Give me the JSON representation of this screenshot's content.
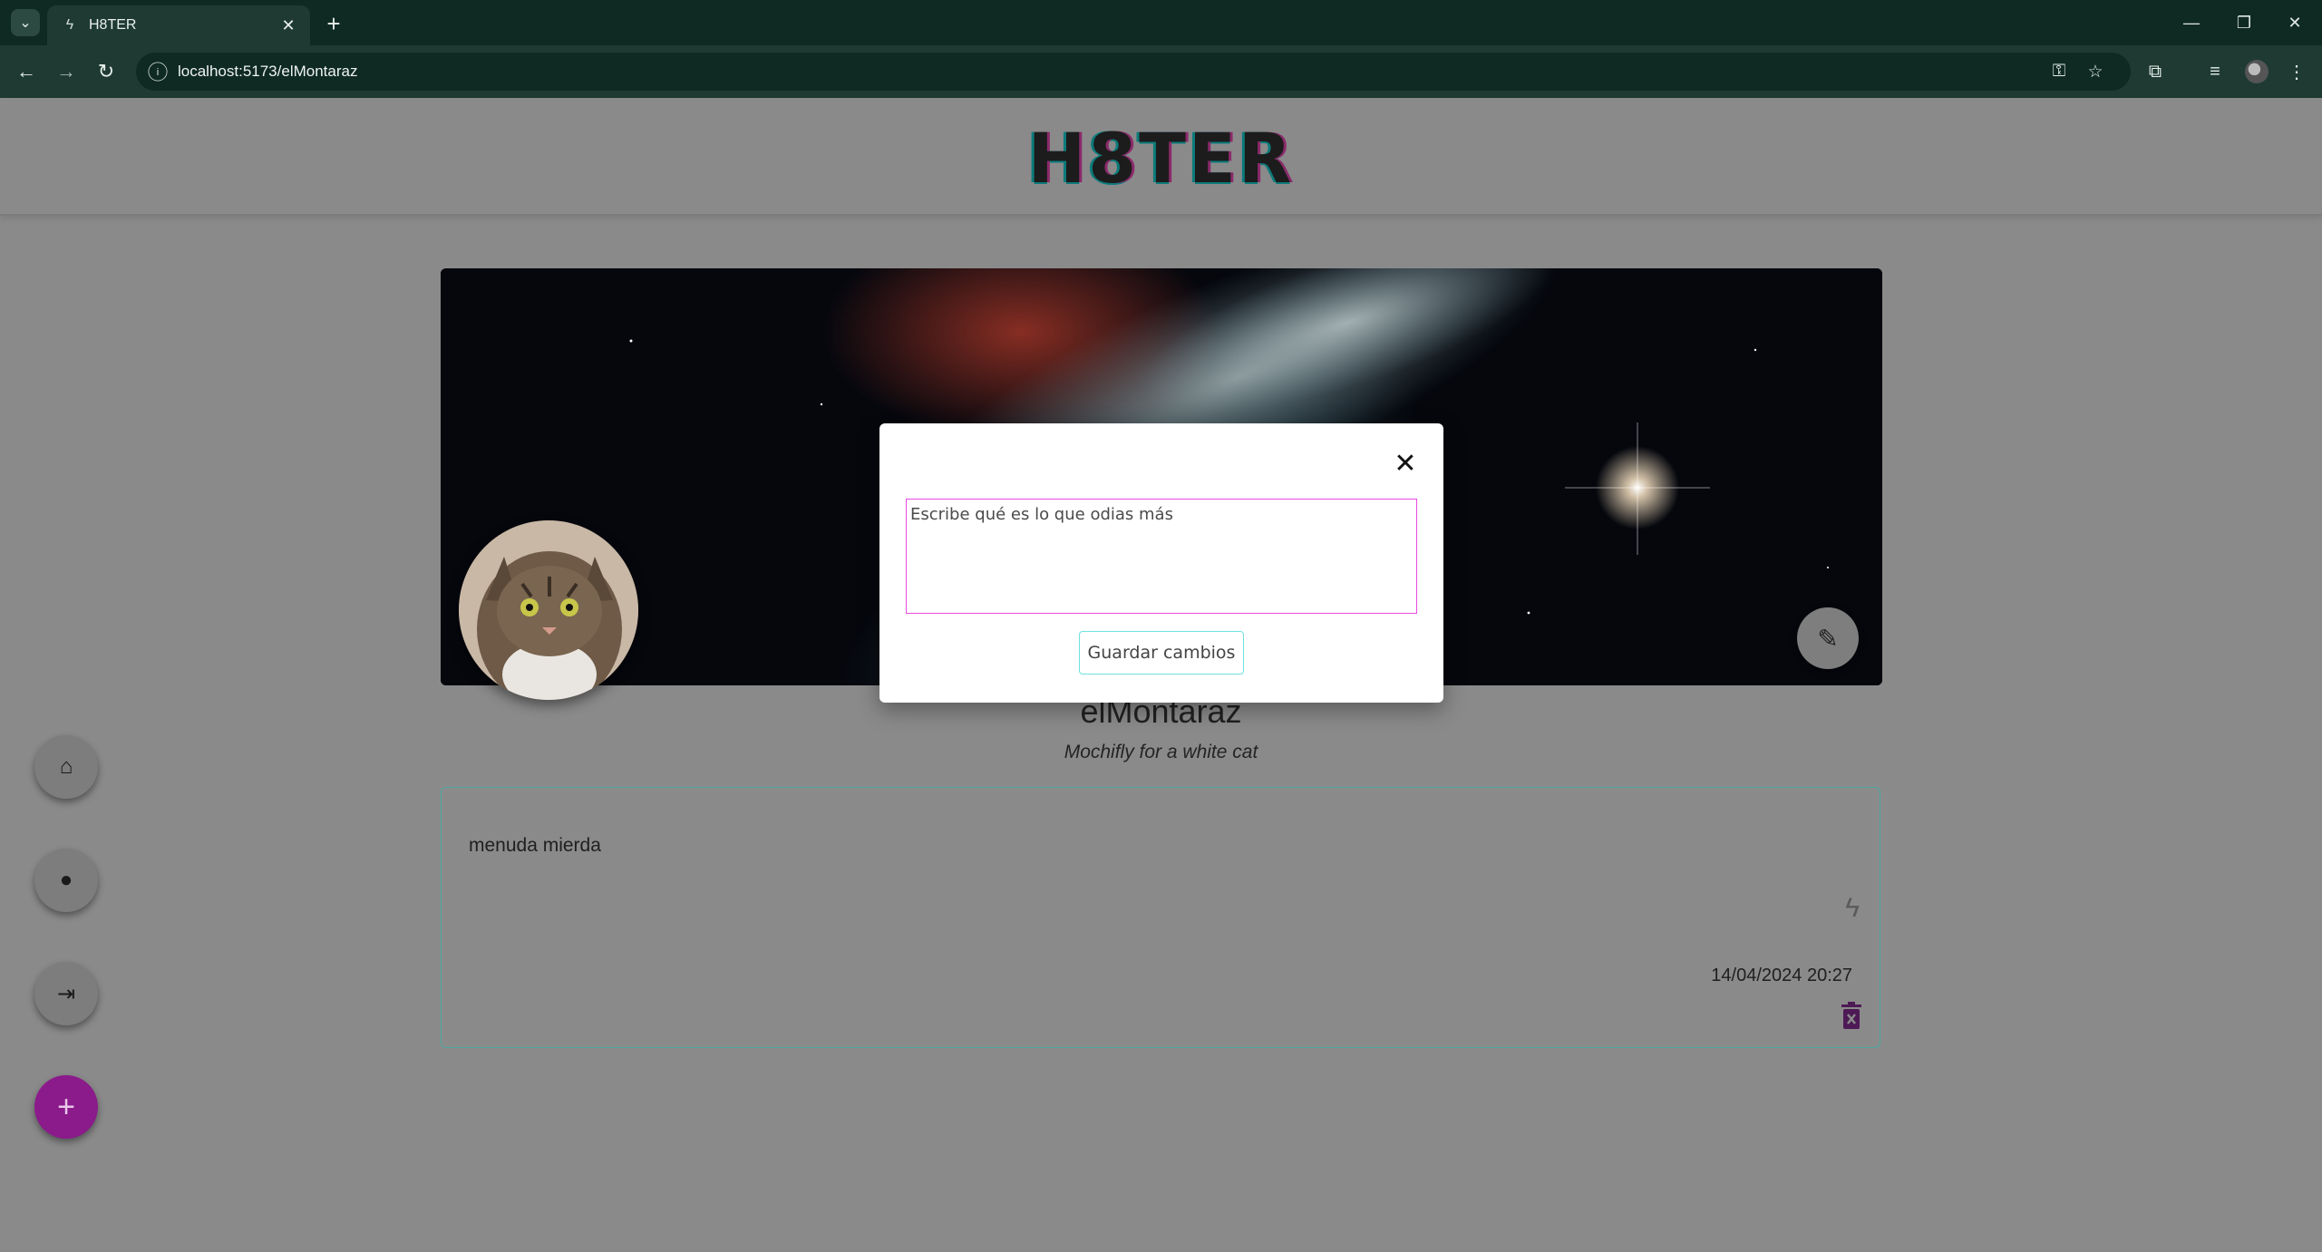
{
  "browser": {
    "tab_title": "H8TER",
    "url": "localhost:5173/elMontaraz",
    "icons": [
      "tab-list-icon",
      "favicon-bolt-icon",
      "close-icon",
      "plus-icon",
      "minimize-icon",
      "restore-icon",
      "close-window-icon",
      "back-icon",
      "forward-icon",
      "reload-icon",
      "site-info-icon",
      "password-key-icon",
      "bookmark-star-icon",
      "extensions-icon",
      "media-queue-icon",
      "profile-icon",
      "kebab-menu-icon"
    ]
  },
  "header": {
    "logo": "H8TER"
  },
  "profile": {
    "username": "elMontaraz",
    "bio": "Mochifly for a white cat"
  },
  "posts": [
    {
      "text": "menuda mierda",
      "date": "14/04/2024 20:27"
    }
  ],
  "modal": {
    "textarea_placeholder": "Escribe qué es lo que odias más",
    "save_label": "Guardar cambios"
  },
  "sidebar": {
    "items": [
      "home-icon",
      "user-icon",
      "logout-icon",
      "add-icon"
    ]
  },
  "colors": {
    "chrome_dark": "#0f2a23",
    "chrome_toolbar": "#1e3a33",
    "overlay_gray": "#8a8a8a",
    "accent_pink": "#e94ae0",
    "accent_teal": "#6ee2e2",
    "fab_purple": "#8b1a8b"
  }
}
